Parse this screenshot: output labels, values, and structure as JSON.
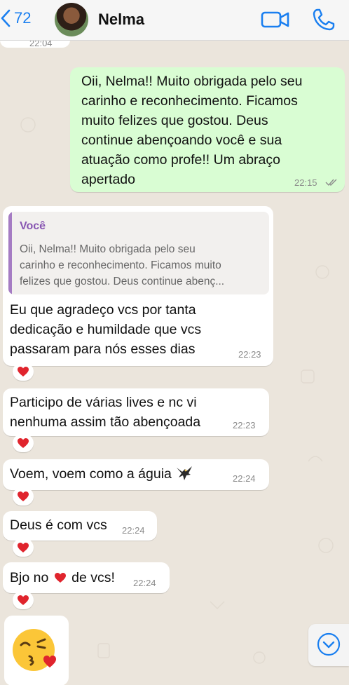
{
  "header": {
    "back_count": "72",
    "contact_name": "Nelma"
  },
  "messages": {
    "prev_time": "22:04",
    "m1": {
      "text": "Oii, Nelma!! Muito obrigada pelo seu\ncarinho e reconhecimento. Ficamos\nmuito felizes que gostou. Deus\ncontinue abençoando você e sua\natuação como profe!! Um abraço\napertado",
      "time": "22:15"
    },
    "m2": {
      "quote_author": "Você",
      "quote_text": "Oii, Nelma!! Muito obrigada pelo seu\ncarinho e reconhecimento. Ficamos muito\nfelizes que gostou. Deus continue abenç...",
      "text": "Eu que agradeço vcs por tanta\ndedicação e humildade que vcs\npassaram para nós esses dias",
      "time": "22:23"
    },
    "m3": {
      "text": "Participo de várias lives e nc vi\nnenhuma assim tão abençoada",
      "time": "22:23"
    },
    "m4": {
      "text": "Voem, voem como a águia",
      "time": "22:24"
    },
    "m5": {
      "text": "Deus é com vcs",
      "time": "22:24"
    },
    "m6": {
      "text_before": "Bjo no",
      "text_after": "de vcs!",
      "time": "22:24"
    }
  },
  "colors": {
    "accent": "#1a7ff0",
    "outgoing_bubble": "#d9fdd3",
    "incoming_bubble": "#ffffff",
    "quote_author": "#8856b2",
    "reaction_heart": "#e0242d"
  },
  "icons": {
    "back": "chevron-left-icon",
    "video": "video-camera-icon",
    "call": "phone-icon",
    "read": "double-check-icon",
    "reaction": "red-heart-icon",
    "eagle": "eagle-icon",
    "kiss": "face-blowing-kiss-icon",
    "scroll": "chevron-down-circle-icon"
  }
}
